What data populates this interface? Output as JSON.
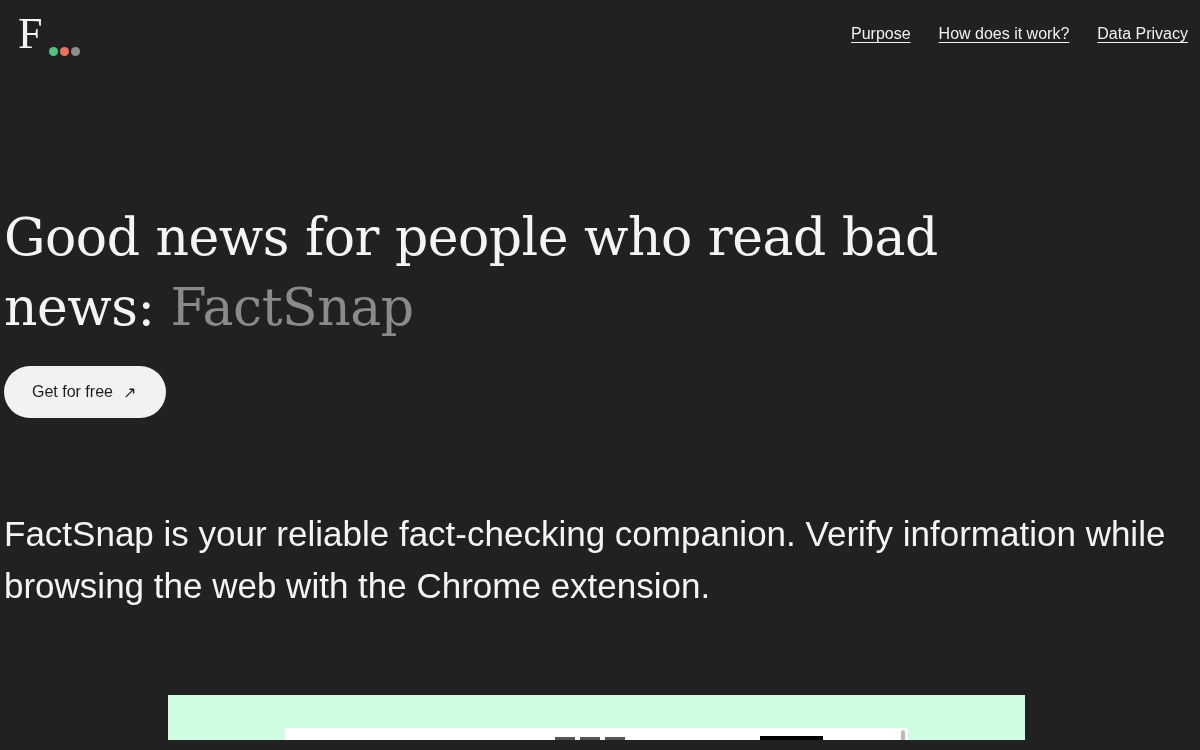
{
  "logo": {
    "letter": "F",
    "dots": [
      {
        "color": "#4cc47f"
      },
      {
        "color": "#f0705a"
      },
      {
        "color": "#8f8c8c"
      }
    ]
  },
  "nav": {
    "links": [
      "Purpose",
      "How does it work?",
      "Data Privacy"
    ]
  },
  "hero": {
    "headline": "Good news for people who read bad news:",
    "headline_highlight": "FactSnap",
    "button": {
      "label": "Get for free",
      "icon": "↗"
    },
    "description": "FactSnap is your reliable fact-checking companion. Verify information while browsing the web with the Chrome extension."
  }
}
